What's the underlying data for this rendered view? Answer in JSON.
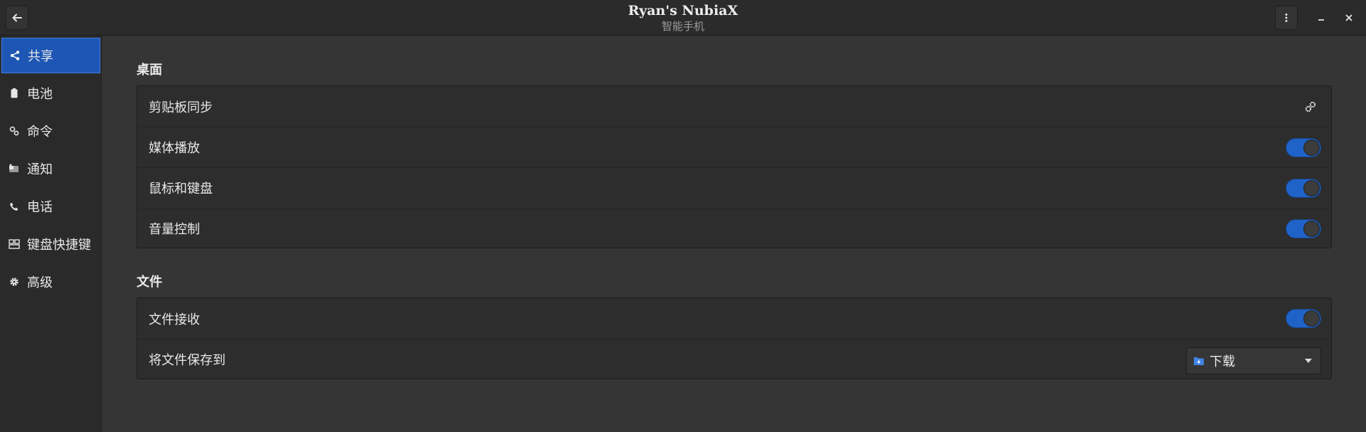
{
  "header": {
    "title": "Ryan's NubiaX",
    "subtitle": "智能手机"
  },
  "sidebar": {
    "items": [
      {
        "label": "共享",
        "icon": "share-icon",
        "active": true
      },
      {
        "label": "电池",
        "icon": "battery-icon"
      },
      {
        "label": "命令",
        "icon": "command-icon"
      },
      {
        "label": "通知",
        "icon": "notification-icon"
      },
      {
        "label": "电话",
        "icon": "phone-icon"
      },
      {
        "label": "键盘快捷键",
        "icon": "keyboard-shortcuts-icon"
      },
      {
        "label": "高级",
        "icon": "gear-icon"
      }
    ]
  },
  "sections": {
    "desktop": {
      "title": "桌面",
      "rows": [
        {
          "label": "剪贴板同步",
          "control": "settings-action",
          "icon": "settings-action-icon"
        },
        {
          "label": "媒体播放",
          "control": "toggle",
          "on": true
        },
        {
          "label": "鼠标和键盘",
          "control": "toggle",
          "on": true
        },
        {
          "label": "音量控制",
          "control": "toggle",
          "on": true
        }
      ]
    },
    "files": {
      "title": "文件",
      "rows": [
        {
          "label": "文件接收",
          "control": "toggle",
          "on": true
        },
        {
          "label": "将文件保存到",
          "control": "dropdown",
          "value": "下载",
          "icon": "download-folder-icon"
        }
      ]
    }
  },
  "colors": {
    "accent": "#1f63c9",
    "window_bg": "#353535",
    "sidebar_bg": "#2a2a2a",
    "card_bg": "#2d2d2d"
  }
}
